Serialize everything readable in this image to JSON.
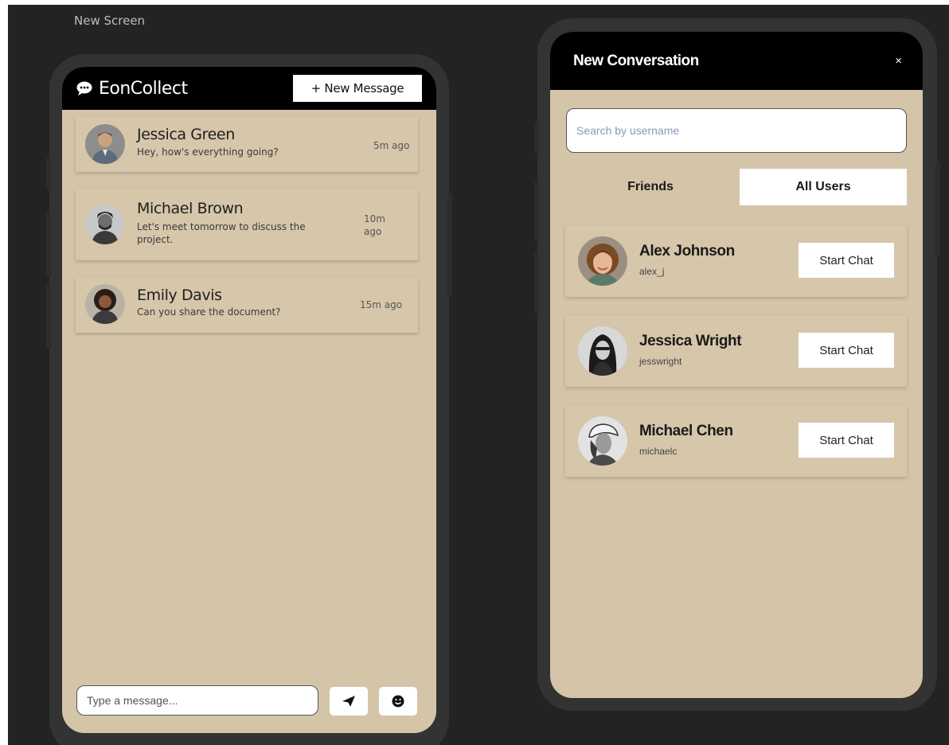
{
  "canvas": {
    "frame_label": "New Screen"
  },
  "messages_screen": {
    "app_name": "EonCollect",
    "new_message_label": "+ New Message",
    "conversations": [
      {
        "name": "Jessica Green",
        "message": "Hey, how's everything going?",
        "time": "5m ago"
      },
      {
        "name": "Michael Brown",
        "message": "Let's meet tomorrow to discuss the project.",
        "time": "10m ago"
      },
      {
        "name": "Emily Davis",
        "message": "Can you share the document?",
        "time": "15m ago"
      }
    ],
    "composer": {
      "placeholder": "Type a message...",
      "send_icon": "send-icon",
      "emoji_icon": "emoji-icon"
    }
  },
  "new_conversation": {
    "title": "New Conversation",
    "close_label": "×",
    "search_placeholder": "Search by username",
    "tabs": [
      {
        "label": "Friends",
        "active": false
      },
      {
        "label": "All Users",
        "active": true
      }
    ],
    "users": [
      {
        "name": "Alex Johnson",
        "username": "alex_j",
        "action": "Start Chat"
      },
      {
        "name": "Jessica Wright",
        "username": "jesswright",
        "action": "Start Chat"
      },
      {
        "name": "Michael Chen",
        "username": "michaelc",
        "action": "Start Chat"
      }
    ]
  },
  "colors": {
    "background": "#232323",
    "phone_body": "#333333",
    "screen": "#d4c4a8",
    "header": "#000000"
  }
}
